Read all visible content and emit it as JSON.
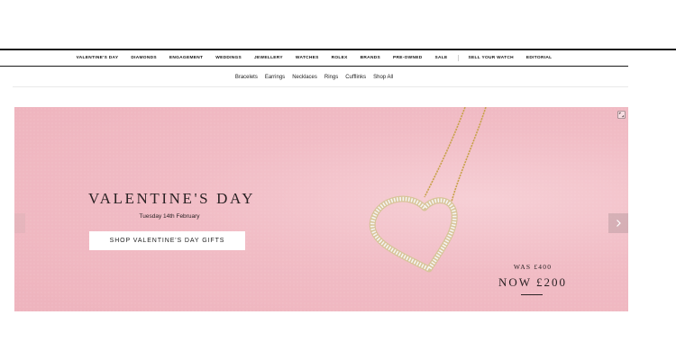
{
  "main_nav": {
    "items": [
      "VALENTINE'S DAY",
      "DIAMONDS",
      "ENGAGEMENT",
      "WEDDINGS",
      "JEWELLERY",
      "WATCHES",
      "ROLEX",
      "BRANDS",
      "PRE-OWNED",
      "SALE"
    ],
    "extra_items": [
      "SELL YOUR WATCH",
      "EDITORIAL"
    ]
  },
  "sub_nav": {
    "items": [
      "Bracelets",
      "Earrings",
      "Necklaces",
      "Rings",
      "Cufflinks",
      "Shop All"
    ]
  },
  "hero": {
    "title": "VALENTINE'S DAY",
    "date": "Tuesday 14th February",
    "cta_label": "SHOP VALENTINE'S DAY GIFTS",
    "was_price": "WAS £400",
    "now_price": "NOW £200",
    "colors": {
      "background": "#f1bcc5",
      "text": "#2a2224",
      "chain": "#c9a24e",
      "diamond": "#f4f4f4"
    }
  },
  "icons": {
    "expand": "expand-icon",
    "next": "chevron-right-icon",
    "prev": "chevron-left-icon"
  }
}
